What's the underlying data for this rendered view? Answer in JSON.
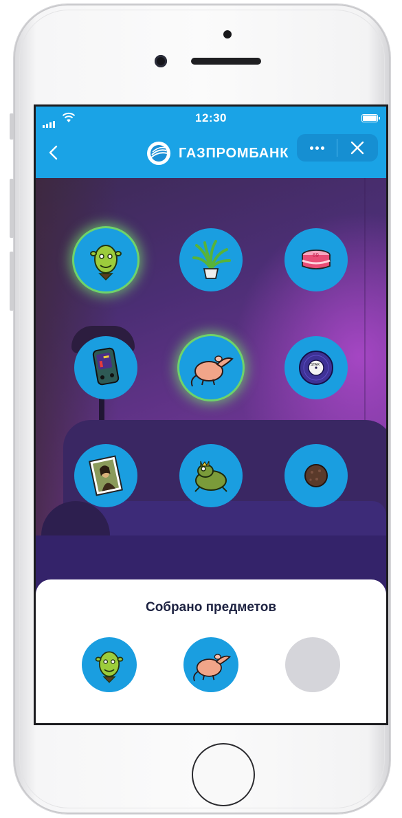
{
  "status_bar": {
    "time": "12:30"
  },
  "nav": {
    "logo_text": "ГАЗПРОМБАНК",
    "back_icon": "chevron-left-icon",
    "more_icon": "more-horizontal-icon",
    "close_icon": "close-icon"
  },
  "collection": {
    "items": [
      {
        "name": "ogre",
        "collected": true
      },
      {
        "name": "plant",
        "collected": false
      },
      {
        "name": "cake",
        "collected": false
      },
      {
        "name": "game-console",
        "collected": false
      },
      {
        "name": "rat",
        "collected": true
      },
      {
        "name": "vinyl-record",
        "collected": false
      },
      {
        "name": "mona-lisa-painting",
        "collected": false
      },
      {
        "name": "frog-prince",
        "collected": false
      },
      {
        "name": "meatball",
        "collected": false
      }
    ]
  },
  "sheet": {
    "title": "Собрано предметов",
    "slots": [
      {
        "name": "ogre",
        "filled": true
      },
      {
        "name": "rat",
        "filled": true
      },
      {
        "name": "empty",
        "filled": false
      }
    ]
  },
  "colors": {
    "brand_blue": "#1aa3e6",
    "item_blue": "#1a9ee0",
    "glow_green": "#6fd36a",
    "title_navy": "#1d2241",
    "empty_slot": "#d5d5da"
  }
}
